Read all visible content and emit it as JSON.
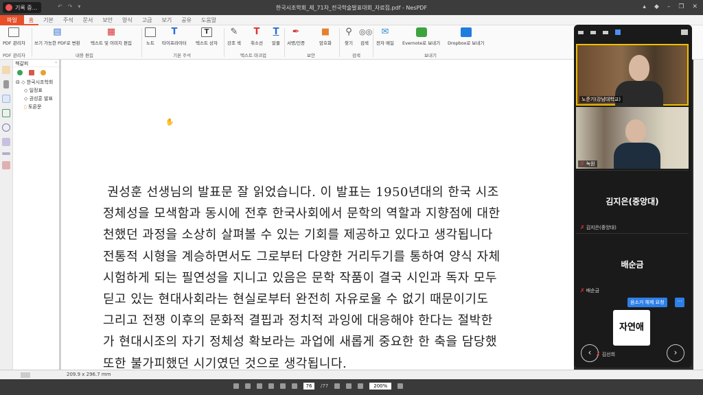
{
  "titlebar": {
    "recording_label": "기록 중...",
    "document_title": "한국시조학회_제_71차_전국학술발표대회_자료집.pdf - NesPDF"
  },
  "menu": {
    "tabs": [
      "파일",
      "홈",
      "기본",
      "주석",
      "문서",
      "보안",
      "양식",
      "고급",
      "보기",
      "공유",
      "도움말"
    ],
    "active": "홈"
  },
  "ribbon": {
    "buttons": {
      "pdf_manager": "PDF 관리자",
      "make_editable": "쓰기 가능한 PDF로 변환",
      "edit_text_image": "텍스트 및 이미지 편집",
      "note": "노트",
      "typewriter": "타이프라이터",
      "textbox": "텍스트 상자",
      "highlight": "강조 색",
      "strikeout": "취소선",
      "underline": "밑줄",
      "sign": "서명/인증",
      "encrypt": "암호화",
      "find": "찾기",
      "search": "검색",
      "email": "전자 메일",
      "evernote": "Evernote로 보내기",
      "dropbox": "Dropbox로 보내기"
    },
    "groups": {
      "pdf_manager": "PDF 관리자",
      "content_edit": "내용 편집",
      "basic_annot": "기본 주석",
      "text_markup": "텍스트 마크업",
      "security": "보안",
      "search": "검색",
      "send": "보내기"
    }
  },
  "bookmarks": {
    "header": "책갈피",
    "items": [
      {
        "label": "한국시조학회",
        "level": 0
      },
      {
        "label": "일정표",
        "level": 1
      },
      {
        "label": "권성훈 발표",
        "level": 1
      },
      {
        "label": "토론문",
        "level": 1
      }
    ]
  },
  "document": {
    "lines": [
      " 권성훈 선생님의 발표문 잘 읽었습니다. 이 발표는 1950년대의 한국 시조",
      "정체성을 모색함과 동시에 전후 한국사회에서 문학의 역할과 지향점에 대한",
      "천했던 과정을 소상히 살펴볼 수 있는 기회를 제공하고 있다고 생각됩니다",
      "전통적 시형을 계승하면서도 그로부터 다양한 거리두기를 통하여 양식 자체",
      "시험하게 되는 필연성을 지니고 있음은 문학 작품이 결국 시인과 독자 모두",
      "딛고 있는 현대사회라는 현실로부터 완전히 자유로울 수 없기 때문이기도",
      "그리고 전쟁 이후의 문화적 결핍과 정치적 과잉에 대응해야 한다는 절박한",
      "가 현대시조의 자기 정체성 확보라는 과업에 새롭게 중요한 한 축을 담당했",
      "또한 불가피했던 시기였던 것으로 생각됩니다."
    ]
  },
  "status": {
    "page_size": "209.9 x 296.7 mm",
    "current_page": "76",
    "total_pages": "/77",
    "zoom": "200%"
  },
  "meeting": {
    "participants": [
      {
        "label": "노준기(강남대학교)",
        "type": "video",
        "muted": false
      },
      {
        "label": "녹원",
        "type": "video",
        "muted": true
      },
      {
        "name": "김지은(중앙대)",
        "label": "김지은(중앙대)",
        "type": "name",
        "muted": true
      },
      {
        "name": "배순금",
        "label": "배순금",
        "type": "name",
        "muted": true
      },
      {
        "label": "김선희",
        "type": "avatar",
        "muted": true,
        "avatar_text": "자연애"
      }
    ],
    "unmute_request": "음소거 해제 요청",
    "more": "···",
    "prev": "‹",
    "next": "›"
  },
  "colors": {
    "accent": "#e8502b",
    "active_speaker": "#f0c000",
    "zoom_blue": "#2d7fe8"
  }
}
